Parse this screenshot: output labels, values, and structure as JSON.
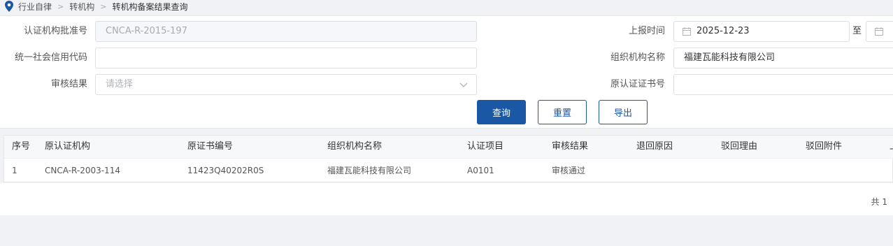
{
  "breadcrumb": {
    "items": [
      "行业自律",
      "转机构",
      "转机构备案结果查询"
    ]
  },
  "search": {
    "cert_org_approval_no": {
      "label": "认证机构批准号",
      "value": "CNCA-R-2015-197"
    },
    "report_time": {
      "label": "上报时间",
      "start": "2025-12-23",
      "to": "至",
      "end": ""
    },
    "credit_code": {
      "label": "统一社会信用代码",
      "value": ""
    },
    "org_name": {
      "label": "组织机构名称",
      "value": "福建瓦能科技有限公司"
    },
    "audit_result": {
      "label": "审核结果",
      "placeholder": "请选择"
    },
    "orig_cert_no": {
      "label": "原认证证书号",
      "value": ""
    },
    "buttons": {
      "query": "查询",
      "reset": "重置",
      "export": "导出"
    }
  },
  "table": {
    "headers": [
      "序号",
      "原认证机构",
      "原证书编号",
      "组织机构名称",
      "认证项目",
      "审核结果",
      "退回原因",
      "驳回理由",
      "驳回附件",
      "上"
    ],
    "rows": [
      [
        "1",
        "CNCA-R-2003-114",
        "11423Q40202R0S",
        "福建瓦能科技有限公司",
        "A0101",
        "审核通过",
        "",
        "",
        "",
        ""
      ]
    ]
  },
  "pagination": {
    "total_label": "共 1"
  },
  "colors": {
    "primary": "#1a57a5",
    "pin": "#1a57a5"
  }
}
